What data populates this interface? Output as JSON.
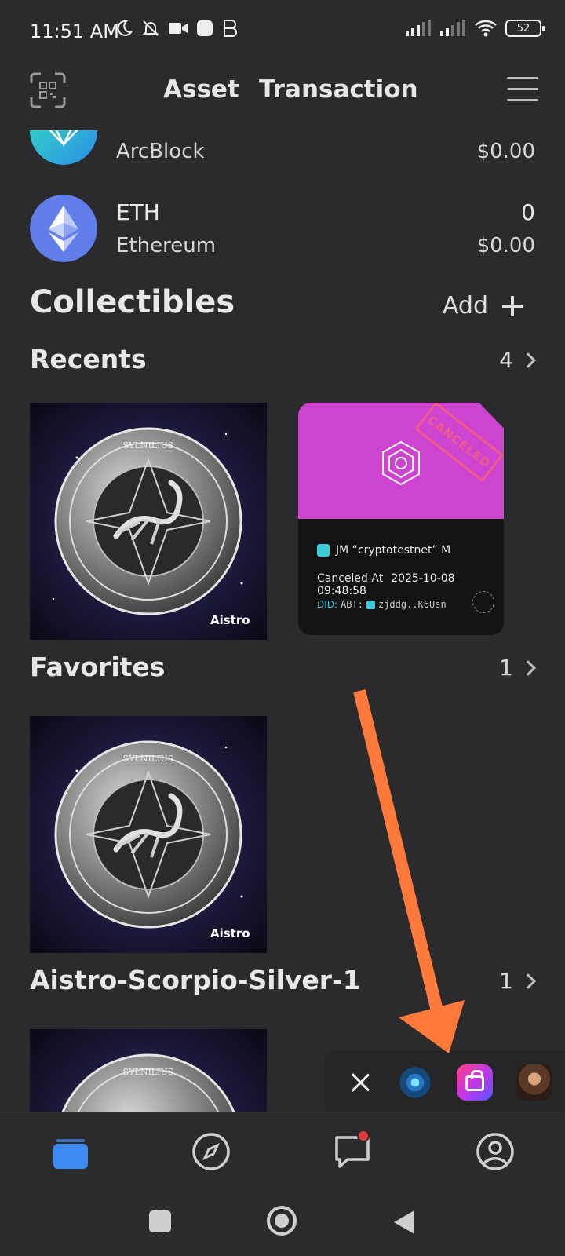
{
  "status_bar": {
    "time": "11:51 AM",
    "battery": "52",
    "left_icons": [
      "moon-icon",
      "bell-off-icon",
      "video-icon",
      "app-square-icon",
      "app-b-icon"
    ],
    "right_icons": [
      "signal-icon",
      "signal-icon",
      "wifi-icon",
      "battery-icon"
    ]
  },
  "header": {
    "tabs": [
      {
        "label": "Asset",
        "active": true
      },
      {
        "label": "Transaction",
        "active": false
      }
    ],
    "left_icon": "scan-icon",
    "right_icon": "menu-icon"
  },
  "tokens": [
    {
      "name": "",
      "subtitle": "ArcBlock",
      "amount": "",
      "value": "$0.00",
      "logo_color": "#2fd3c8"
    },
    {
      "name": "ETH",
      "subtitle": "Ethereum",
      "amount": "0",
      "value": "$0.00",
      "logo_color": "#627eea"
    }
  ],
  "collectibles": {
    "title": "Collectibles",
    "add_label": "Add"
  },
  "sections": [
    {
      "title": "Recents",
      "count": "4"
    },
    {
      "title": "Favorites",
      "count": "1"
    },
    {
      "title": "Aistro-Scorpio-Silver-1",
      "count": "1"
    }
  ],
  "nft": {
    "watermark": "Aistro",
    "coin_text": "SYLNILIUS"
  },
  "ticket": {
    "stamp": "CANCELED",
    "holder": "JM “cryptotestnet” M",
    "canceled_label": "Canceled At",
    "canceled_at": "2025-10-08 09:48:58",
    "did_prefix": "DID:",
    "did_chain": "ABT:",
    "did_value": "zjddg..K6Usn",
    "top_color": "#cc44d0"
  },
  "dock": {
    "apps": [
      "close-icon",
      "molecule-app-icon",
      "shop-bag-app-icon",
      "portrait-app-icon"
    ]
  },
  "bottom_nav": {
    "items": [
      "wallet-icon",
      "compass-icon",
      "chat-icon",
      "profile-icon"
    ],
    "active": "wallet-icon",
    "accent": "#3d8bf2"
  },
  "annotation": {
    "arrow_color": "#ff7a3a"
  }
}
